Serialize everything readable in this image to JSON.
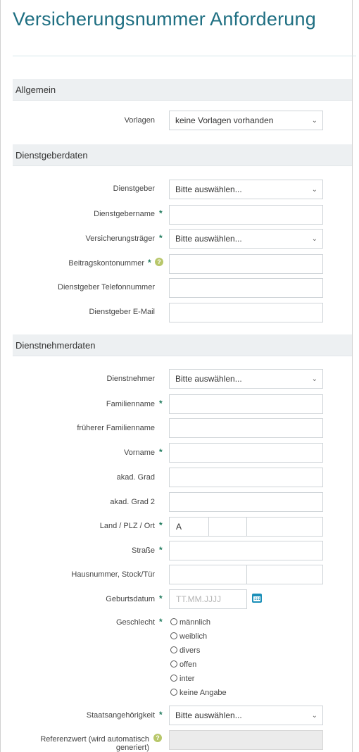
{
  "title": "Versicherungsnummer Anforderung",
  "sections": {
    "allgemein": "Allgemein",
    "dienstgeber": "Dienstgeberdaten",
    "dienstnehmer": "Dienstnehmerdaten"
  },
  "allgemein": {
    "vorlagen_label": "Vorlagen",
    "vorlagen_value": "keine Vorlagen vorhanden"
  },
  "dienstgeber": {
    "dienstgeber_label": "Dienstgeber",
    "dienstgeber_value": "Bitte auswählen...",
    "name_label": "Dienstgebername",
    "traeger_label": "Versicherungsträger",
    "traeger_value": "Bitte auswählen...",
    "beitragskonto_label": "Beitragskontonummer",
    "telefon_label": "Dienstgeber Telefonnummer",
    "email_label": "Dienstgeber E-Mail"
  },
  "dienstnehmer": {
    "dienstnehmer_label": "Dienstnehmer",
    "dienstnehmer_value": "Bitte auswählen...",
    "familienname_label": "Familienname",
    "frueherer_label": "früherer Familienname",
    "vorname_label": "Vorname",
    "grad_label": "akad. Grad",
    "grad2_label": "akad. Grad 2",
    "land_label": "Land / PLZ / Ort",
    "land_value": "A",
    "strasse_label": "Straße",
    "hausnummer_label": "Hausnummer, Stock/Tür",
    "geburtsdatum_label": "Geburtsdatum",
    "geburtsdatum_placeholder": "TT.MM.JJJJ",
    "geschlecht_label": "Geschlecht",
    "geschlecht_options": [
      "männlich",
      "weiblich",
      "divers",
      "offen",
      "inter",
      "keine Angabe"
    ],
    "staat_label": "Staatsangehörigkeit",
    "staat_value": "Bitte auswählen...",
    "referenz_label": "Referenzwert (wird automatisch generiert)"
  },
  "required_marker": "*",
  "help_marker": "?",
  "icons": {
    "select_chevron": "chevron-down-icon",
    "calendar": "calendar-icon",
    "help": "help-icon"
  },
  "colors": {
    "title": "#1f6f82",
    "section_bg": "#edf0f2",
    "required": "#1f7a5c",
    "help": "#b8c76a",
    "calendar": "#1b8fb8"
  }
}
